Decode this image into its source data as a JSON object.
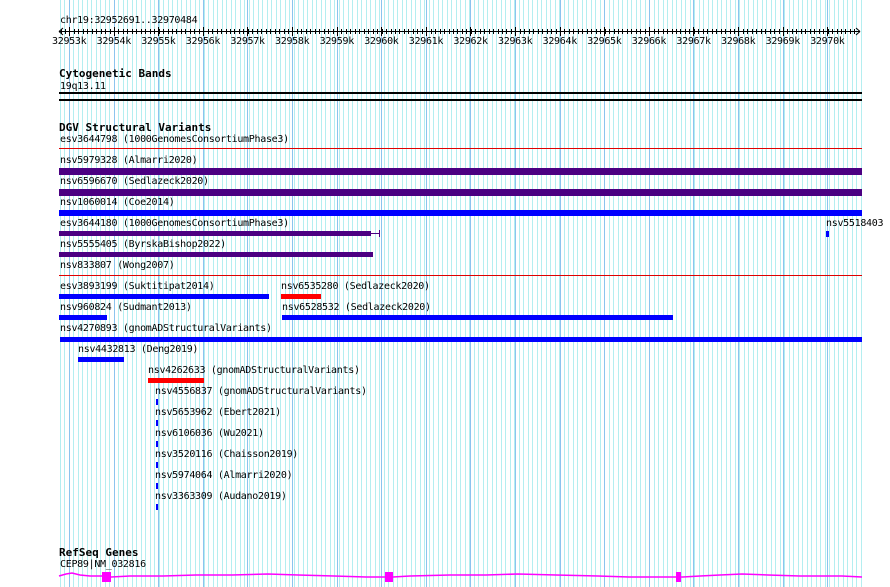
{
  "ruler": {
    "location": "chr19:32952691..32970484",
    "ticks": [
      "32953k",
      "32954k",
      "32955k",
      "32956k",
      "32957k",
      "32958k",
      "32959k",
      "32960k",
      "32961k",
      "32962k",
      "32963k",
      "32964k",
      "32965k",
      "32966k",
      "32967k",
      "32968k",
      "32969k",
      "32970k"
    ]
  },
  "cyto": {
    "title": "Cytogenetic Bands",
    "band": "19q13.11"
  },
  "dgv": {
    "title": "DGV Structural Variants",
    "features": [
      {
        "id": "esv3644798",
        "source": "(1000GenomesConsortiumPhase3)",
        "color": "#e00000"
      },
      {
        "id": "nsv5979328",
        "source": "(Almarri2020)",
        "color": "#4b0082"
      },
      {
        "id": "nsv6596670",
        "source": "(Sedlazeck2020)",
        "color": "#4b0082"
      },
      {
        "id": "nsv1060014",
        "source": "(Coe2014)",
        "color": "#0000ff"
      },
      {
        "id": "esv3644180",
        "source": "(1000GenomesConsortiumPhase3)",
        "color": "#4b0082"
      },
      {
        "id": "nsv5518403",
        "source": "",
        "color": "#0000ff"
      },
      {
        "id": "nsv5555405",
        "source": "(ByrskaBishop2022)",
        "color": "#4b0082"
      },
      {
        "id": "nsv833807",
        "source": "(Wong2007)",
        "color": "#e00000"
      },
      {
        "id": "esv3893199",
        "source": "(Suktitipat2014)",
        "color": "#0000ff"
      },
      {
        "id": "nsv6535280",
        "source": "(Sedlazeck2020)",
        "color": "#ff0000"
      },
      {
        "id": "nsv960824",
        "source": "(Sudmant2013)",
        "color": "#0000ff"
      },
      {
        "id": "nsv6528532",
        "source": "(Sedlazeck2020)",
        "color": "#0000ff"
      },
      {
        "id": "nsv4270893",
        "source": "(gnomADStructuralVariants)",
        "color": "#0000ff"
      },
      {
        "id": "nsv4432813",
        "source": "(Deng2019)",
        "color": "#0000ff"
      },
      {
        "id": "nsv4262633",
        "source": "(gnomADStructuralVariants)",
        "color": "#ff0000"
      },
      {
        "id": "nsv4556837",
        "source": "(gnomADStructuralVariants)",
        "color": "#0000ff"
      },
      {
        "id": "nsv5653962",
        "source": "(Ebert2021)",
        "color": "#0000ff"
      },
      {
        "id": "nsv6106036",
        "source": "(Wu2021)",
        "color": "#0000ff"
      },
      {
        "id": "nsv3520116",
        "source": "(Chaisson2019)",
        "color": "#0000ff"
      },
      {
        "id": "nsv5974064",
        "source": "(Almarri2020)",
        "color": "#0000ff"
      },
      {
        "id": "nsv3363309",
        "source": "(Audano2019)",
        "color": "#0000ff"
      }
    ]
  },
  "refseq": {
    "title": "RefSeq Genes",
    "gene": "CEP89|NM_032816",
    "color": "#ff00ff"
  }
}
